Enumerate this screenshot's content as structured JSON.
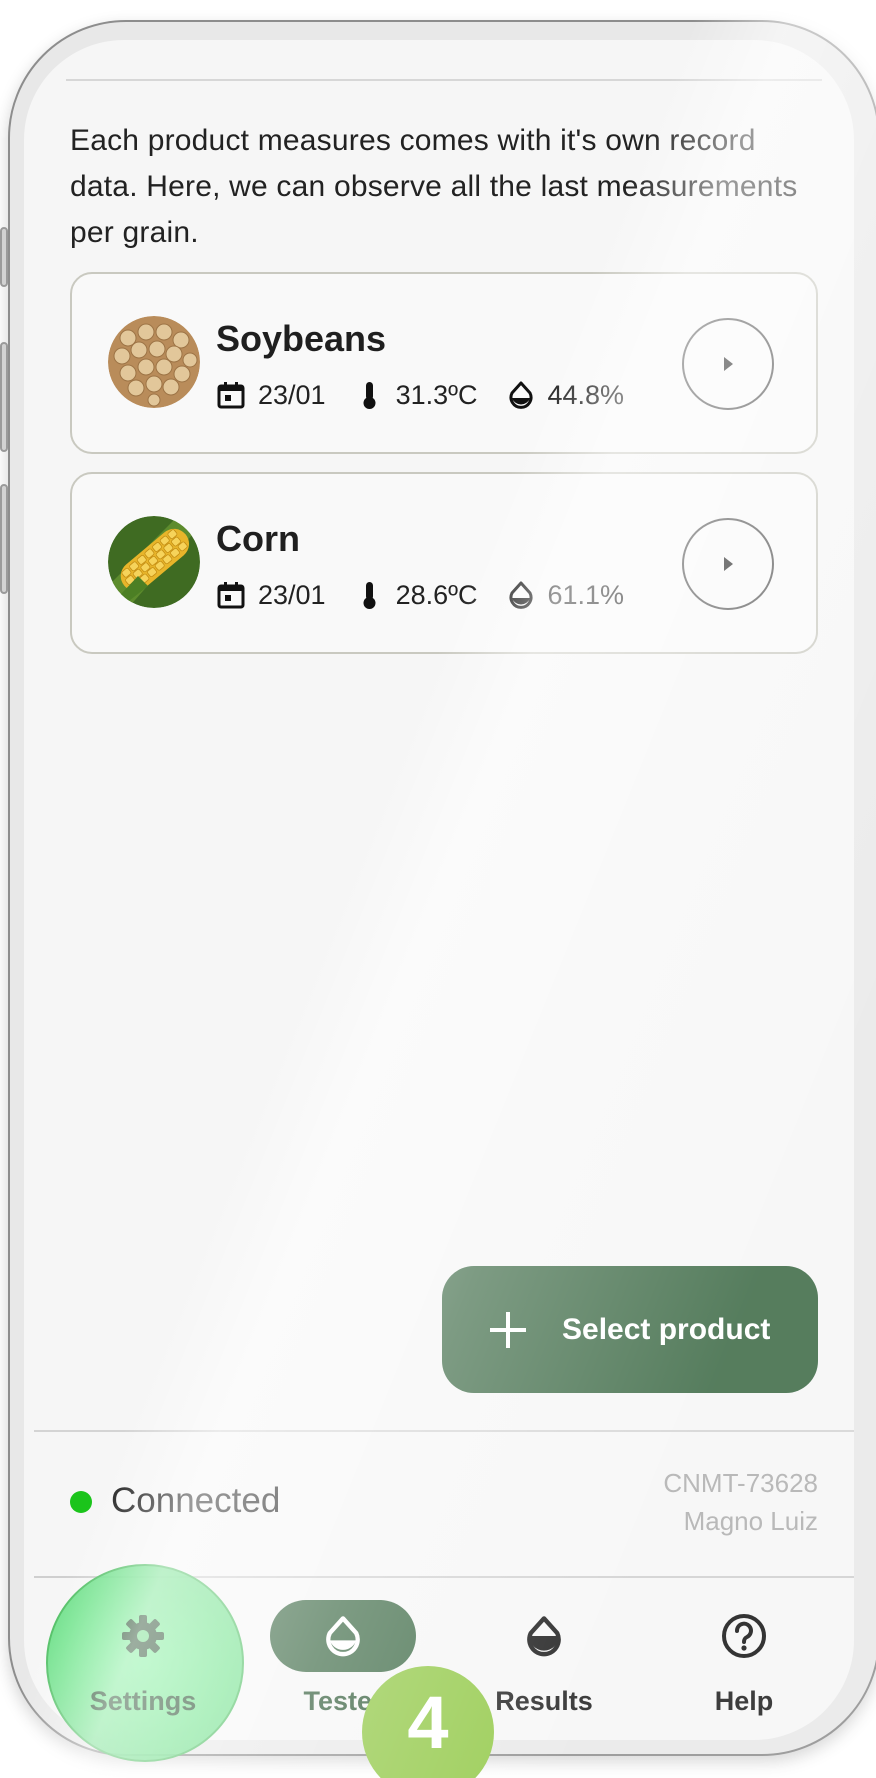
{
  "intro_text": "Each product measures comes with it's own record data. Here, we can observe all the last measurements per grain.",
  "products": [
    {
      "name": "Soybeans",
      "date": "23/01",
      "temperature": "31.3ºC",
      "moisture": "44.8%",
      "image": "soybeans-photo"
    },
    {
      "name": "Corn",
      "date": "23/01",
      "temperature": "28.6ºC",
      "moisture": "61.1%",
      "image": "corn-photo"
    }
  ],
  "fab": {
    "label": "Select product",
    "icon": "plus-icon"
  },
  "status": {
    "text": "Connected",
    "color": "#1bc41b",
    "device_id": "CNMT-73628",
    "user": "Magno Luiz"
  },
  "nav": [
    {
      "label": "Settings",
      "icon": "gear-icon"
    },
    {
      "label": "Tester",
      "icon": "drop-icon",
      "active": true
    },
    {
      "label": "Results",
      "icon": "drop-filled-icon"
    },
    {
      "label": "Help",
      "icon": "help-circle-icon"
    }
  ],
  "tutorial_step": "4",
  "colors": {
    "primary": "#386641",
    "highlight": "#78f096",
    "badge": "#8dc63f"
  }
}
